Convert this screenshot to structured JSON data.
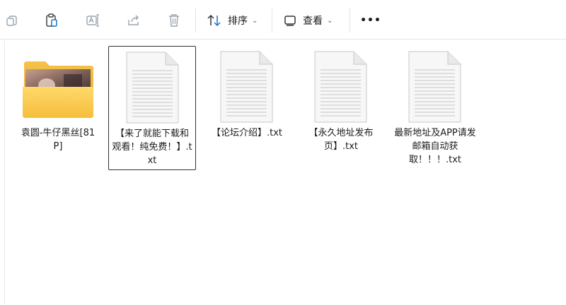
{
  "toolbar": {
    "sort_label": "排序",
    "view_label": "查看",
    "more_label": "•••"
  },
  "files": [
    {
      "name": "袁圆-牛仔黑丝[81P]",
      "type": "folder"
    },
    {
      "name": "【来了就能下载和观看！纯免费！】.txt",
      "type": "txt",
      "selected": true
    },
    {
      "name": "【论坛介绍】.txt",
      "type": "txt"
    },
    {
      "name": "【永久地址发布页】.txt",
      "type": "txt"
    },
    {
      "name": "最新地址及APP请发邮箱自动获取！！！.txt",
      "type": "txt"
    }
  ]
}
